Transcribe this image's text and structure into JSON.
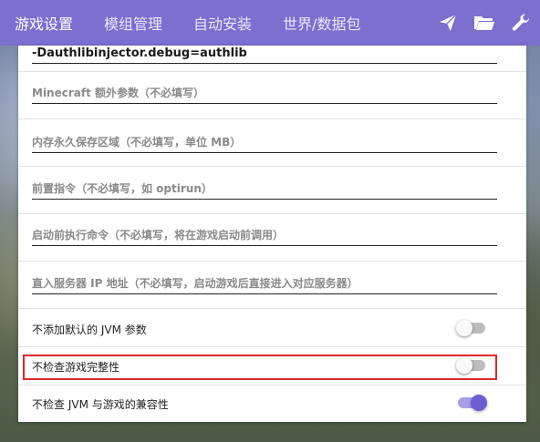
{
  "nav": {
    "tabs": [
      {
        "label": "游戏设置",
        "active": true
      },
      {
        "label": "模组管理",
        "active": false
      },
      {
        "label": "自动安装",
        "active": false
      },
      {
        "label": "世界/数据包",
        "active": false
      }
    ],
    "icons": [
      "send-icon",
      "folder-open-icon",
      "wrench-icon"
    ]
  },
  "settings": {
    "jvm_args_value": "-Dauthlibinjector.debug=authlib",
    "minecraft_args_placeholder": "Minecraft 额外参数（不必填写）",
    "permgen_placeholder": "内存永久保存区域（不必填写，单位 MB）",
    "wrapper_placeholder": "前置指令（不必填写，如 optirun）",
    "pre_launch_placeholder": "启动前执行命令（不必填写，将在游戏启动前调用）",
    "server_ip_placeholder": "直入服务器 IP 地址（不必填写，启动游戏后直接进入对应服务器）",
    "toggles": [
      {
        "label": "不添加默认的 JVM 参数",
        "on": false
      },
      {
        "label": "不检查游戏完整性",
        "on": false
      },
      {
        "label": "不检查 JVM 与游戏的兼容性",
        "on": true
      }
    ]
  },
  "colors": {
    "accent": "#7b6fd0",
    "highlight": "#e0262a"
  }
}
